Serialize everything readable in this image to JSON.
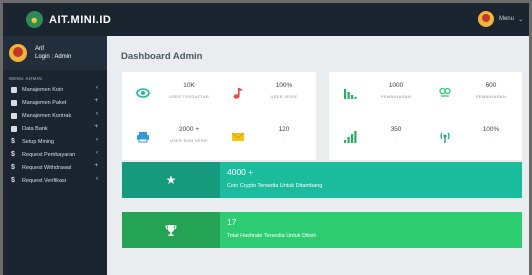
{
  "topbar": {
    "logo_text": "AIT.MINI.ID",
    "user_label": "Menu",
    "chevron": "⌄"
  },
  "sidebar": {
    "profile": {
      "name": "Arif",
      "role": "Login : Admin"
    },
    "menu_header": "MENU ADMIN",
    "items": [
      {
        "label": "Manajemen Koin",
        "icon": "table-icon",
        "right": "‹"
      },
      {
        "label": "Manajemen Paket",
        "icon": "table-icon",
        "right": "+"
      },
      {
        "label": "Manajemen Kontrak",
        "icon": "table-icon",
        "right": "‹"
      },
      {
        "label": "Data Bank",
        "icon": "table-icon",
        "right": "+"
      },
      {
        "label": "Setup Mining",
        "icon": "dollar-icon",
        "right": "‹"
      },
      {
        "label": "Request Pembayaran",
        "icon": "dollar-icon",
        "right": "‹"
      },
      {
        "label": "Request Withdrawal",
        "icon": "dollar-icon",
        "right": "+"
      },
      {
        "label": "Request Verifikasi",
        "icon": "dollar-icon",
        "right": "‹"
      }
    ]
  },
  "main": {
    "title": "Dashboard Admin",
    "stats": [
      {
        "value": "10K",
        "label": "USER TERDAFTAR",
        "icon": "eye-icon",
        "color": "#1abc9c"
      },
      {
        "value": "100%",
        "label": "USER VERIF",
        "icon": "music-icon",
        "color": "#e74c3c"
      },
      {
        "value": "1000",
        "label": "PEMBAYARAN",
        "icon": "bar-chart-icon",
        "color": "#27ae60"
      },
      {
        "value": "600",
        "label": "PEMBAYARAN",
        "icon": "link-icon",
        "color": "#2ecc71"
      },
      {
        "value": "2000 +",
        "label": "USER NON VERIF",
        "icon": "printer-icon",
        "color": "#3498db"
      },
      {
        "value": "120",
        "label": "-",
        "icon": "envelope-icon",
        "color": "#f1c40f"
      },
      {
        "value": "350",
        "label": "-",
        "icon": "bar-chart-icon",
        "color": "#27ae60"
      },
      {
        "value": "100%",
        "label": "-",
        "icon": "signal-icon",
        "color": "#16a085"
      }
    ],
    "banners": [
      {
        "value": "4000 +",
        "description": "Coin Crypto Tersedia Untuk Ditambang",
        "icon": "star-icon",
        "icon_bg": "#169a7e",
        "bg": "#1abc9c"
      },
      {
        "value": "17",
        "description": "Total Hashrate Tersedia Untuk Dibeli",
        "icon": "trophy-icon",
        "icon_bg": "#25a355",
        "bg": "#2ecc71"
      }
    ]
  }
}
